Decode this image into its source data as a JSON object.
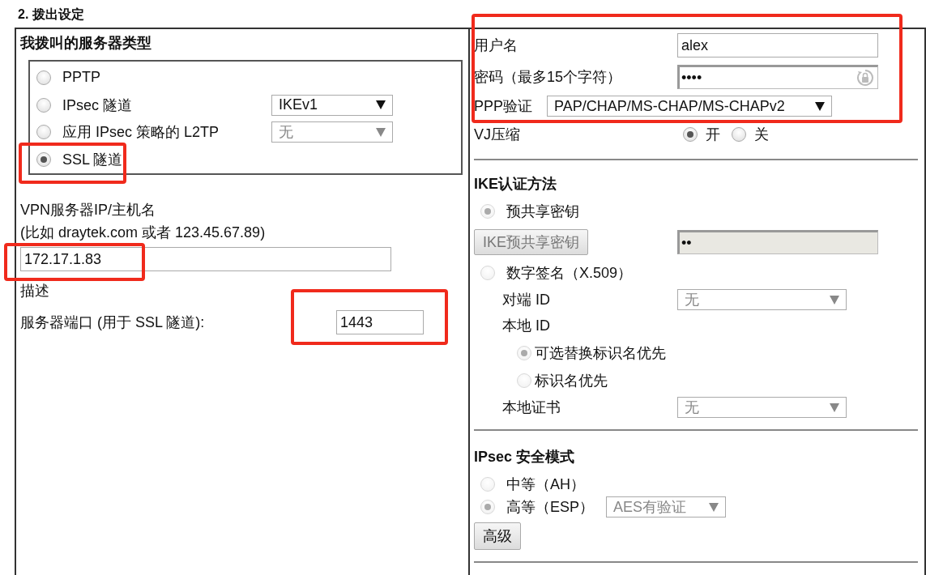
{
  "section_title": "2. 拨出设定",
  "server_type": {
    "title": "我拨叫的服务器类型",
    "options": [
      {
        "label": "PPTP",
        "selected": false
      },
      {
        "label": "IPsec 隧道",
        "selected": false,
        "select": {
          "value": "IKEv1",
          "disabled": false
        }
      },
      {
        "label": "应用 IPsec 策略的 L2TP",
        "selected": false,
        "select": {
          "value": "无",
          "disabled": true
        }
      },
      {
        "label": "SSL 隧道",
        "selected": true
      }
    ]
  },
  "vpn_server": {
    "label": "VPN服务器IP/主机名",
    "hint": "(比如 draytek.com 或者 123.45.67.89)",
    "value": "172.17.1.83"
  },
  "description": {
    "label": "描述"
  },
  "server_port": {
    "label": "服务器端口 (用于 SSL 隧道):",
    "value": "1443"
  },
  "username": {
    "label": "用户名",
    "value": "alex"
  },
  "password": {
    "label": "密码（最多15个字符）",
    "value": "••••"
  },
  "ppp_auth": {
    "label": "PPP验证",
    "value": "PAP/CHAP/MS-CHAP/MS-CHAPv2"
  },
  "vj_compression": {
    "label": "VJ压缩",
    "options": [
      {
        "label": "开",
        "selected": true
      },
      {
        "label": "关",
        "selected": false
      }
    ]
  },
  "ike_auth": {
    "title": "IKE认证方法",
    "disabled": true,
    "psk": {
      "label": "预共享密钥",
      "selected": true
    },
    "psk_button": "IKE预共享密钥",
    "psk_value": "••",
    "signature": {
      "label": "数字签名（X.509）",
      "selected": false
    },
    "peer_id": {
      "label": "对端 ID",
      "value": "无"
    },
    "local_id": {
      "label": "本地 ID",
      "options": [
        {
          "label": "可选替换标识名优先",
          "selected": true
        },
        {
          "label": "标识名优先",
          "selected": false
        }
      ]
    },
    "local_cert": {
      "label": "本地证书",
      "value": "无"
    }
  },
  "ipsec_mode": {
    "title": "IPsec 安全模式",
    "options": [
      {
        "label": "中等（AH）",
        "selected": false
      },
      {
        "label": "高等（ESP）",
        "selected": true
      }
    ],
    "cipher": {
      "value": "AES有验证",
      "disabled": true
    },
    "advanced_button": "高级"
  }
}
